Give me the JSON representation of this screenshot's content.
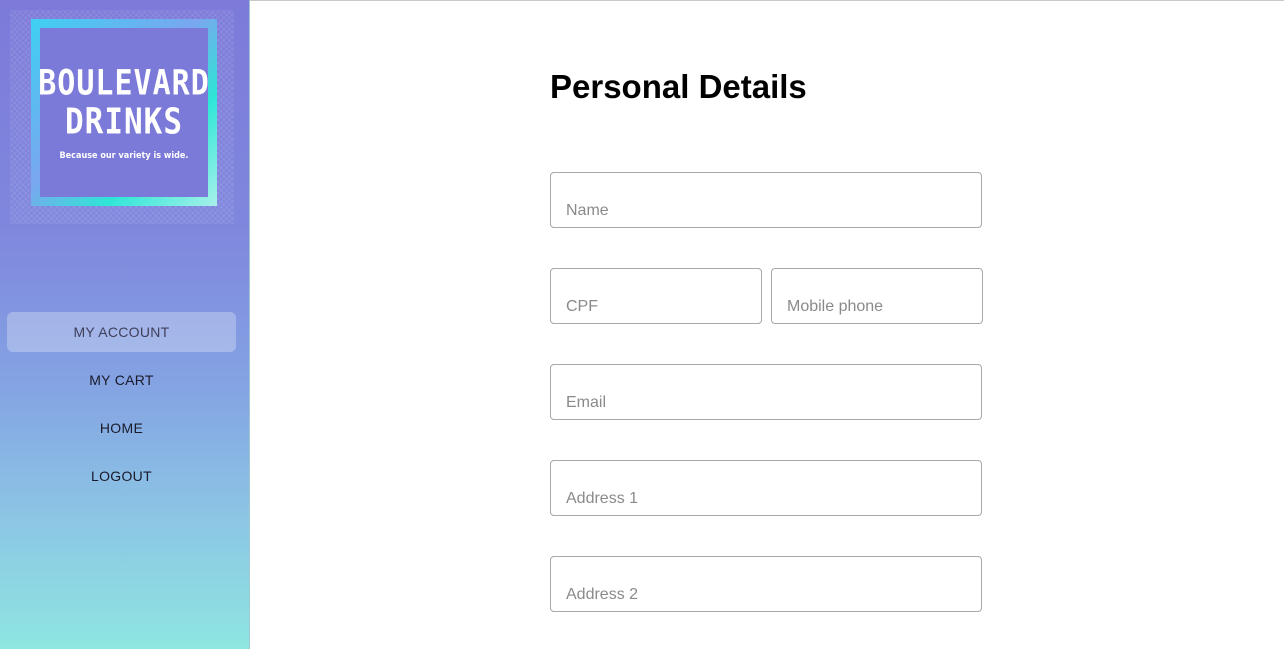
{
  "brand": {
    "line1": "BOULEVARD",
    "line2": "DRINKS",
    "tagline": "Because our variety is wide."
  },
  "nav": {
    "items": [
      {
        "label": "MY ACCOUNT",
        "active": true
      },
      {
        "label": "MY CART",
        "active": false
      },
      {
        "label": "HOME",
        "active": false
      },
      {
        "label": "LOGOUT",
        "active": false
      }
    ]
  },
  "page": {
    "title": "Personal Details"
  },
  "form": {
    "name": {
      "placeholder": "Name",
      "value": ""
    },
    "cpf": {
      "placeholder": "CPF",
      "value": ""
    },
    "mobile": {
      "placeholder": "Mobile phone",
      "value": ""
    },
    "email": {
      "placeholder": "Email",
      "value": ""
    },
    "address1": {
      "placeholder": "Address 1",
      "value": ""
    },
    "address2": {
      "placeholder": "Address 2",
      "value": ""
    }
  },
  "colors": {
    "sidebar_top": "#7d7ad9",
    "sidebar_bottom": "#8ee6e1",
    "logo_bg": "#7b7ad8"
  }
}
